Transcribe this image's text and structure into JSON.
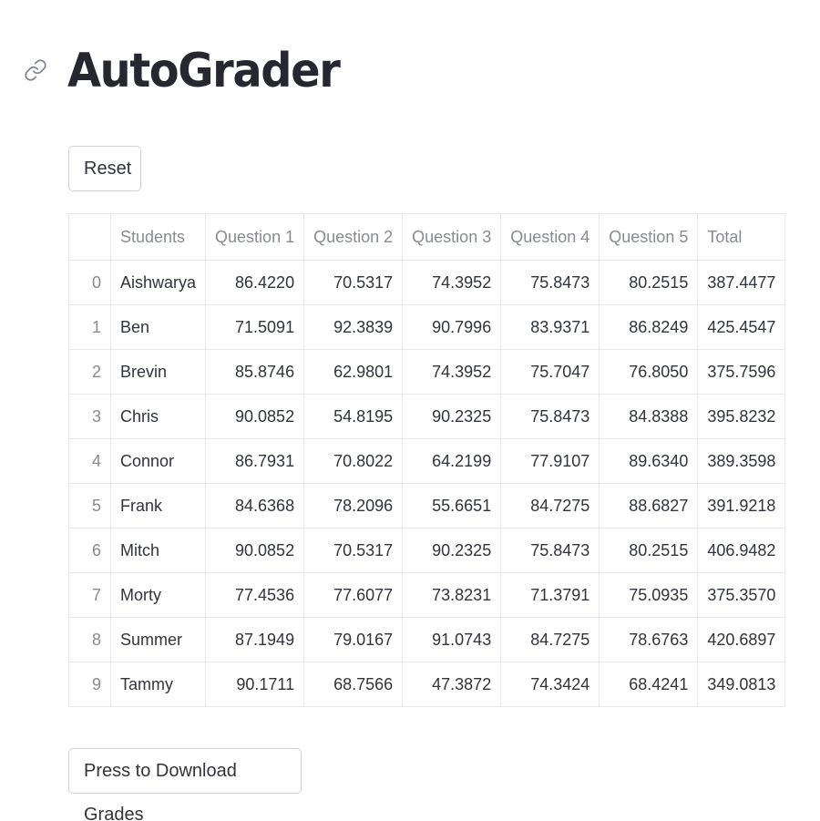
{
  "page": {
    "title": "AutoGrader",
    "anchor_icon": "link-icon"
  },
  "buttons": {
    "reset_label": "Reset",
    "download_label": "Press to Download Grades"
  },
  "table": {
    "headers": [
      "",
      "Students",
      "Question 1",
      "Question 2",
      "Question 3",
      "Question 4",
      "Question 5",
      "Total"
    ],
    "rows": [
      [
        "0",
        "Aishwarya",
        "86.4220",
        "70.5317",
        "74.3952",
        "75.8473",
        "80.2515",
        "387.4477"
      ],
      [
        "1",
        "Ben",
        "71.5091",
        "92.3839",
        "90.7996",
        "83.9371",
        "86.8249",
        "425.4547"
      ],
      [
        "2",
        "Brevin",
        "85.8746",
        "62.9801",
        "74.3952",
        "75.7047",
        "76.8050",
        "375.7596"
      ],
      [
        "3",
        "Chris",
        "90.0852",
        "54.8195",
        "90.2325",
        "75.8473",
        "84.8388",
        "395.8232"
      ],
      [
        "4",
        "Connor",
        "86.7931",
        "70.8022",
        "64.2199",
        "77.9107",
        "89.6340",
        "389.3598"
      ],
      [
        "5",
        "Frank",
        "84.6368",
        "78.2096",
        "55.6651",
        "84.7275",
        "88.6827",
        "391.9218"
      ],
      [
        "6",
        "Mitch",
        "90.0852",
        "70.5317",
        "90.2325",
        "75.8473",
        "80.2515",
        "406.9482"
      ],
      [
        "7",
        "Morty",
        "77.4536",
        "77.6077",
        "73.8231",
        "71.3791",
        "75.0935",
        "375.3570"
      ],
      [
        "8",
        "Summer",
        "87.1949",
        "79.0167",
        "91.0743",
        "84.7275",
        "78.6763",
        "420.6897"
      ],
      [
        "9",
        "Tammy",
        "90.1711",
        "68.7566",
        "47.3872",
        "74.3424",
        "68.4241",
        "349.0813"
      ]
    ]
  },
  "colors": {
    "text": "#31333f",
    "muted": "#888a94",
    "border": "#e6e8ec",
    "background": "#ffffff"
  }
}
